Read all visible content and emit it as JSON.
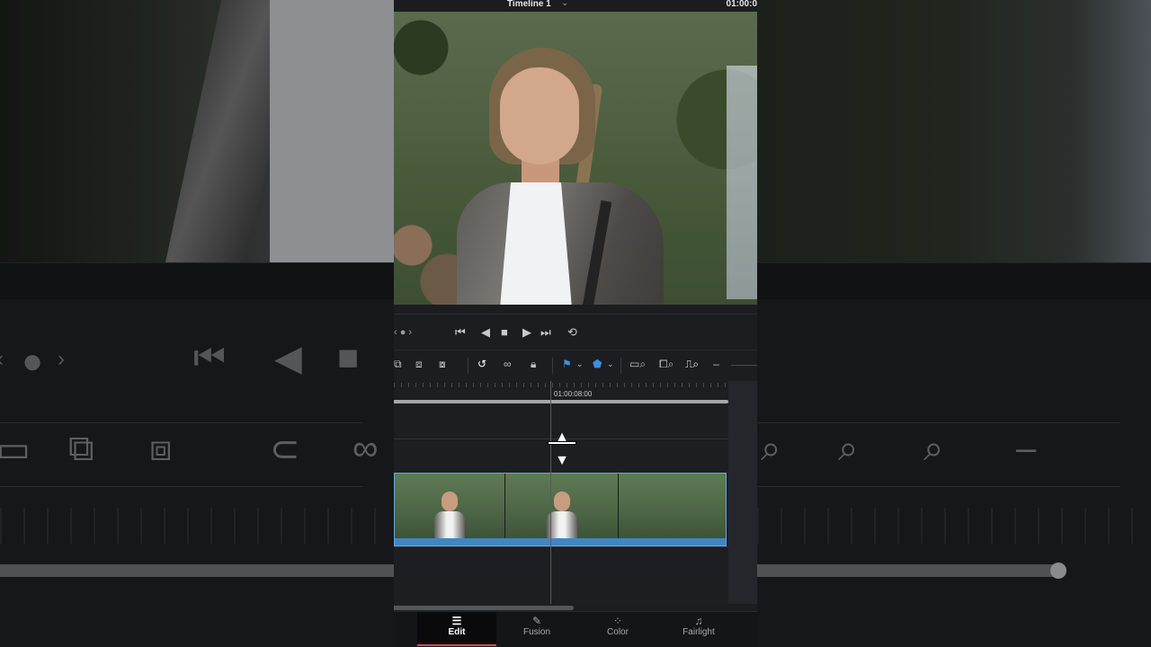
{
  "topbar": {
    "title": "Timeline 1",
    "timecode": "01:00:0"
  },
  "timeline": {
    "ruler_timecode": "01:00:08:00"
  },
  "pages": [
    {
      "label": "Edit",
      "icon": "edit-icon",
      "active": true
    },
    {
      "label": "Fusion",
      "icon": "fusion-icon",
      "active": false
    },
    {
      "label": "Color",
      "icon": "color-icon",
      "active": false
    },
    {
      "label": "Fairlight",
      "icon": "fairlight-icon",
      "active": false
    }
  ],
  "colors": {
    "accent_blue": "#3b8fe0",
    "active_page_underline": "#d24d57",
    "clip_border": "#6aa7e0",
    "audio_strip": "#3f86c7"
  }
}
